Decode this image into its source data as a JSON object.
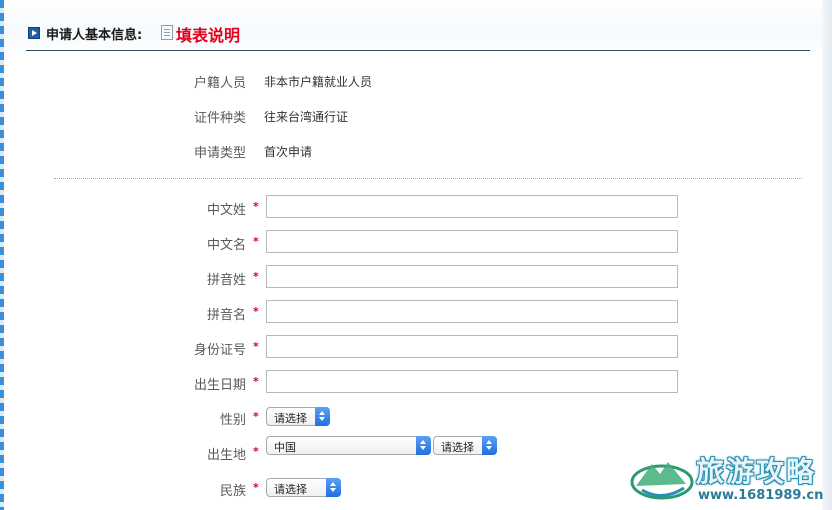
{
  "header": {
    "title": "申请人基本信息:",
    "help_link": "填表说明"
  },
  "applicant_info": [
    {
      "label": "户籍人员",
      "value": "非本市户籍就业人员"
    },
    {
      "label": "证件种类",
      "value": "往来台湾通行证"
    },
    {
      "label": "申请类型",
      "value": "首次申请"
    }
  ],
  "form": {
    "required_mark": "*",
    "surname_cn": {
      "label": "中文姓",
      "value": ""
    },
    "given_name_cn": {
      "label": "中文名",
      "value": ""
    },
    "surname_pinyin": {
      "label": "拼音姓",
      "value": ""
    },
    "given_name_pinyin": {
      "label": "拼音名",
      "value": ""
    },
    "id_number": {
      "label": "身份证号",
      "value": ""
    },
    "birth_date": {
      "label": "出生日期",
      "value": ""
    },
    "gender": {
      "label": "性别",
      "selected": "请选择"
    },
    "birthplace": {
      "label": "出生地",
      "country_selected": "中国",
      "region_selected": "请选择"
    },
    "ethnicity": {
      "label": "民族",
      "selected": "请选择"
    }
  },
  "watermark": {
    "title": "旅游攻略",
    "url": "www.1681989.cn"
  }
}
